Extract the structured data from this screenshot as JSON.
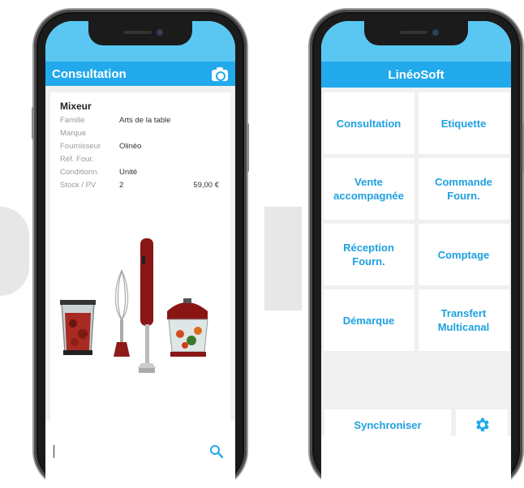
{
  "left_app": {
    "title": "Consultation",
    "camera_icon": "camera-icon",
    "product": {
      "name": "Mixeur",
      "fields": [
        {
          "label": "Famille",
          "value": "Arts de la table",
          "price": ""
        },
        {
          "label": "Marque",
          "value": "",
          "price": ""
        },
        {
          "label": "Fournisseur",
          "value": "Olinéo",
          "price": ""
        },
        {
          "label": "Réf. Four.",
          "value": "",
          "price": ""
        },
        {
          "label": "Conditionn.",
          "value": "Unité",
          "price": ""
        },
        {
          "label": "Stock / PV",
          "value": "2",
          "price": "59,00 €"
        }
      ]
    },
    "search": {
      "placeholder": "",
      "icon": "search-icon"
    }
  },
  "right_app": {
    "title": "LinéoSoft",
    "tiles": [
      {
        "line1": "Consultation",
        "line2": ""
      },
      {
        "line1": "Etiquette",
        "line2": ""
      },
      {
        "line1": "Vente",
        "line2": "accompagnée"
      },
      {
        "line1": "Commande",
        "line2": "Fourn."
      },
      {
        "line1": "Réception",
        "line2": "Fourn."
      },
      {
        "line1": "Comptage",
        "line2": ""
      },
      {
        "line1": "Démarque",
        "line2": ""
      },
      {
        "line1": "Transfert",
        "line2": "Multicanal"
      }
    ],
    "sync_label": "Synchroniser",
    "settings_icon": "gear-icon"
  },
  "colors": {
    "status_bar": "#5ac7f3",
    "app_bar": "#22a9eb",
    "tile_text": "#1ea0e0",
    "background": "#f0f0f0"
  }
}
